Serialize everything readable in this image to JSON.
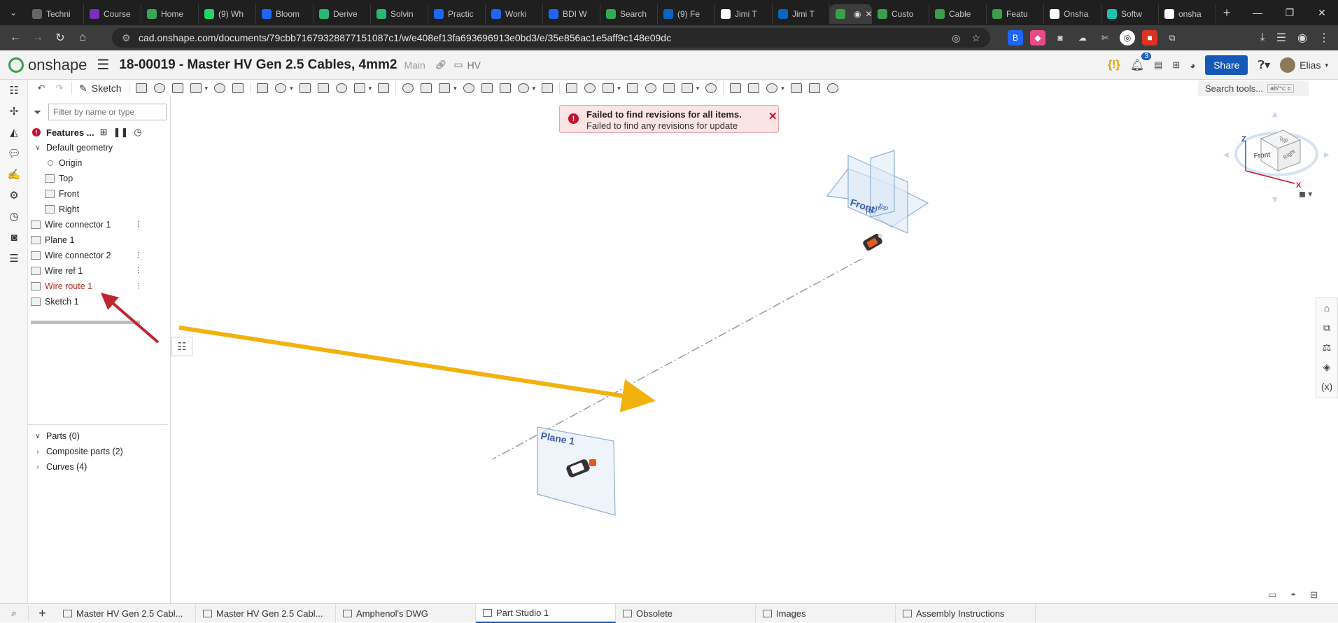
{
  "browser": {
    "tabs": [
      {
        "label": "Techni",
        "color": "#666"
      },
      {
        "label": "Course",
        "color": "#7b2fbe"
      },
      {
        "label": "Home",
        "color": "#34a853"
      },
      {
        "label": "(9) Wh",
        "color": "#25d366"
      },
      {
        "label": "Bloom",
        "color": "#1e66f5"
      },
      {
        "label": "Derive",
        "color": "#2bb673"
      },
      {
        "label": "Solvin",
        "color": "#2bb673"
      },
      {
        "label": "Practic",
        "color": "#1e66f5"
      },
      {
        "label": "Worki",
        "color": "#1e66f5"
      },
      {
        "label": "BDI W",
        "color": "#1e66f5"
      },
      {
        "label": "Search",
        "color": "#34a853"
      },
      {
        "label": "(9) Fe",
        "color": "#0a66c2"
      },
      {
        "label": "Jimi T",
        "color": "#ffffff"
      },
      {
        "label": "Jimi T",
        "color": "#0a66c2"
      },
      {
        "label": "",
        "color": "#3a9e4b",
        "active": true
      },
      {
        "label": "Custo",
        "color": "#3a9e4b"
      },
      {
        "label": "Cable",
        "color": "#3a9e4b"
      },
      {
        "label": "Featu",
        "color": "#3a9e4b"
      },
      {
        "label": "Onsha",
        "color": "#ffffff"
      },
      {
        "label": "Softw",
        "color": "#19c3b0"
      },
      {
        "label": "onsha",
        "color": "#ffffff"
      }
    ],
    "url": "cad.onshape.com/documents/79cbb71679328877151087c1/w/e408ef13fa693696913e0bd3/e/35e856ac1e5aff9c148e09dc"
  },
  "header": {
    "logo": "onshape",
    "title": "18-00019 - Master HV Gen 2.5 Cables, 4mm2",
    "branch": "Main",
    "folder": "HV",
    "notification_count": "3",
    "share_label": "Share",
    "user_name": "Elias",
    "bracket_badge": "{!}"
  },
  "toolbar": {
    "sketch_label": "Sketch",
    "search_placeholder": "Search tools...",
    "search_shortcut": "alt/⌥ c"
  },
  "feature_panel": {
    "filter_placeholder": "Filter by name or type",
    "title": "Features ...",
    "default_geometry": "Default geometry",
    "origin": "Origin",
    "planes": [
      "Top",
      "Front",
      "Right"
    ],
    "features": [
      {
        "label": "Wire connector 1",
        "pinned": true,
        "error": false
      },
      {
        "label": "Plane 1",
        "pinned": false,
        "error": false
      },
      {
        "label": "Wire connector 2",
        "pinned": true,
        "error": false
      },
      {
        "label": "Wire ref 1",
        "pinned": true,
        "error": false
      },
      {
        "label": "Wire route 1",
        "pinned": true,
        "error": true
      },
      {
        "label": "Sketch 1",
        "pinned": false,
        "error": false
      }
    ],
    "parts": "Parts (0)",
    "composite_parts": "Composite parts (2)",
    "curves": "Curves (4)"
  },
  "notification": {
    "title": "Failed to find revisions for all items.",
    "message": "Failed to find any revisions for update"
  },
  "viewport": {
    "plane_front_label": "Front",
    "plane_right_label": "Right",
    "plane_top_label": "Top",
    "plane1_label": "Plane 1",
    "annotation_arrow_color": "#f2b10c",
    "callout_arrow_color": "#c0262d"
  },
  "viewcube": {
    "front": "Front",
    "right": "Right",
    "top": "Top",
    "axis_z": "Z",
    "axis_x": "X"
  },
  "bottom_tabs": [
    {
      "label": "Master HV Gen 2.5 Cabl...",
      "active": false
    },
    {
      "label": "Master HV Gen 2.5 Cabl...",
      "active": false
    },
    {
      "label": "Amphenol's DWG",
      "active": false
    },
    {
      "label": "Part Studio 1",
      "active": true
    },
    {
      "label": "Obsolete",
      "active": false
    },
    {
      "label": "Images",
      "active": false
    },
    {
      "label": "Assembly Instructions",
      "active": false
    }
  ]
}
